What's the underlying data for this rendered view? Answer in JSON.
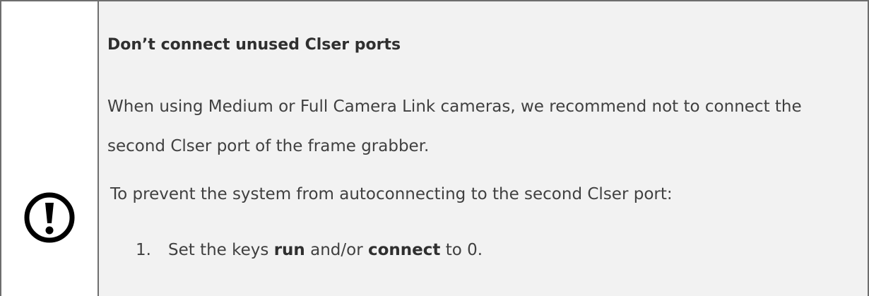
{
  "icon": "exclamation-circle-icon",
  "title": "Don’t connect unused Clser ports",
  "paragraph": "When using Medium or Full Camera Link cameras, we recommend not to connect the second Clser port of the frame grabber.",
  "intro": "To prevent the system from autoconnecting to the second Clser port:",
  "steps": [
    {
      "number": "1.",
      "text_before": "Set the keys ",
      "key1": "run",
      "text_mid": " and/or ",
      "key2": "connect",
      "text_after": " to 0."
    }
  ],
  "colors": {
    "border": "#6e6e6e",
    "content_background": "#f2f2f2",
    "text": "#404040",
    "icon": "#000000"
  }
}
